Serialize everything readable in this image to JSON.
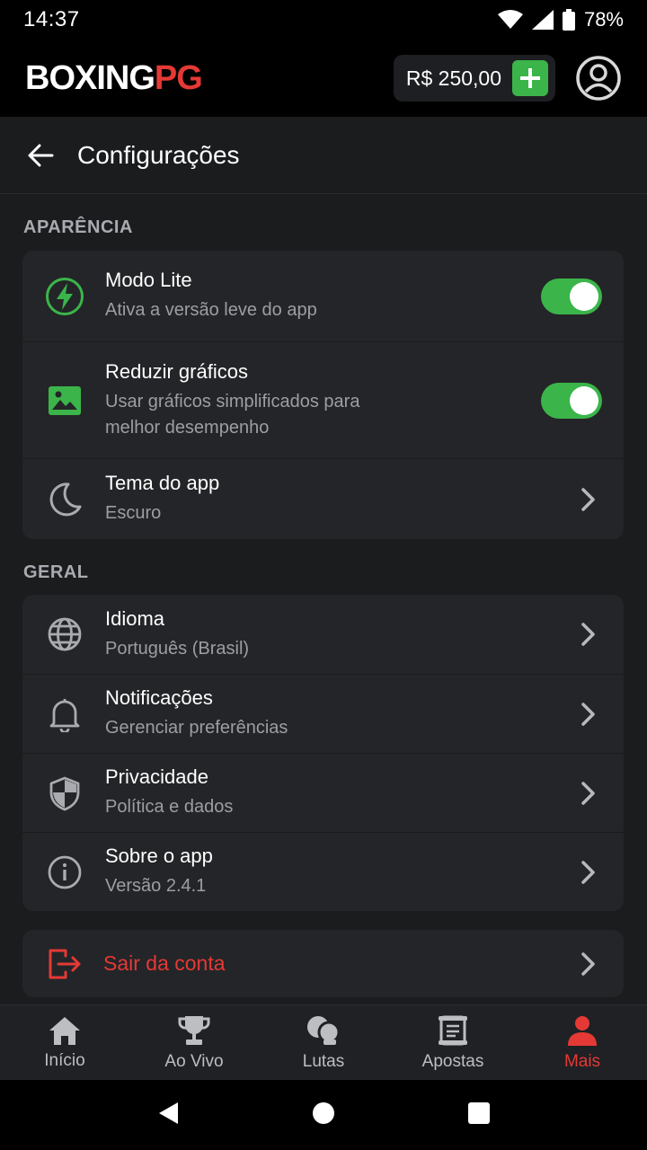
{
  "status_bar": {
    "time": "14:37",
    "battery": "78%"
  },
  "header": {
    "logo_part1": "BOXING",
    "logo_part2": "PG",
    "balance": "R$ 250,00",
    "accent_color": "#e53935",
    "add_color": "#3bb54a"
  },
  "title_bar": {
    "title": "Configurações"
  },
  "appearance": {
    "label": "APARÊNCIA",
    "items": [
      {
        "title": "Modo Lite",
        "subtitle": "Ativa a versão leve do app",
        "icon": "lightning-icon",
        "toggle": true
      },
      {
        "title": "Reduzir gráficos",
        "subtitle": "Usar gráficos simplificados para melhor desempenho",
        "icon": "image-icon",
        "toggle": true
      },
      {
        "title": "Tema do app",
        "subtitle": "Escuro",
        "icon": "moon-icon"
      }
    ]
  },
  "general": {
    "label": "GERAL",
    "items": [
      {
        "title": "Idioma",
        "subtitle": "Português (Brasil)",
        "icon": "globe-icon"
      },
      {
        "title": "Notificações",
        "subtitle": "Gerenciar preferências",
        "icon": "bell-icon"
      },
      {
        "title": "Privacidade",
        "subtitle": "Política e dados",
        "icon": "shield-icon"
      },
      {
        "title": "Sobre o app",
        "subtitle": "Versão 2.4.1",
        "icon": "info-icon"
      }
    ]
  },
  "logout": {
    "label": "Sair da conta",
    "icon": "logout-icon"
  },
  "bottom_nav": {
    "items": [
      {
        "label": "Início",
        "icon": "home-icon"
      },
      {
        "label": "Ao Vivo",
        "icon": "trophy-icon"
      },
      {
        "label": "Lutas",
        "icon": "gloves-icon"
      },
      {
        "label": "Apostas",
        "icon": "ticket-icon"
      },
      {
        "label": "Mais",
        "icon": "person-icon",
        "active": true
      }
    ]
  }
}
